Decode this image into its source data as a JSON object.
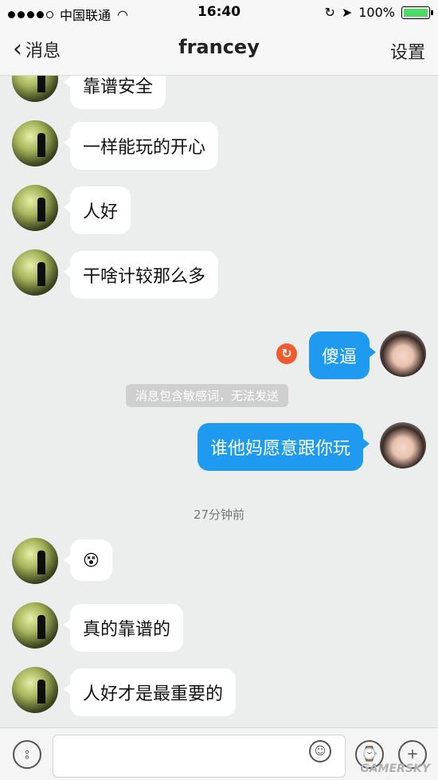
{
  "status_bar": {
    "carrier": "中国联通",
    "time": "16:40",
    "battery": "100%"
  },
  "nav": {
    "back_label": "消息",
    "title": "francey",
    "settings_label": "设置"
  },
  "messages": [
    {
      "side": "in",
      "text": "靠谱安全"
    },
    {
      "side": "in",
      "text": "一样能玩的开心"
    },
    {
      "side": "in",
      "text": "人好"
    },
    {
      "side": "in",
      "text": "干啥计较那么多"
    },
    {
      "side": "out",
      "text": "傻逼",
      "failed": true
    },
    {
      "side": "out",
      "text": "谁他妈愿意跟你玩"
    },
    {
      "side": "in",
      "text": "😵"
    },
    {
      "side": "in",
      "text": "真的靠谱的"
    },
    {
      "side": "in",
      "text": "人好才是最重要的"
    }
  ],
  "system_notice": "消息包含敏感词，无法发送",
  "timestamp": "27分钟前",
  "input": {
    "placeholder": ""
  },
  "watermark": "GAMERSKY",
  "colors": {
    "outgoing_bubble": "#1e9bf0",
    "error": "#f05a2d",
    "battery": "#4cd964"
  }
}
